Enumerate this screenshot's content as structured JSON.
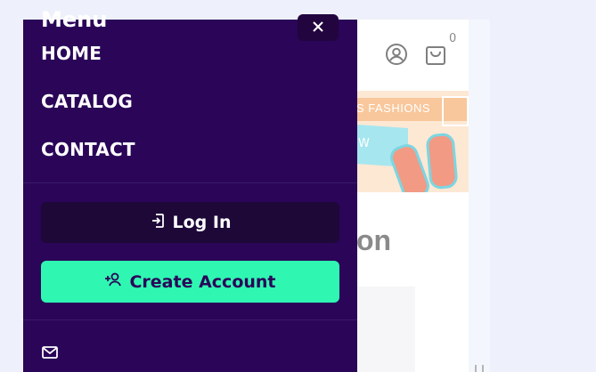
{
  "drawer": {
    "title": "Menu",
    "nav": [
      {
        "label": "HOME"
      },
      {
        "label": "CATALOG"
      },
      {
        "label": "CONTACT"
      }
    ],
    "login_label": "Log In",
    "create_account_label": "Create Account",
    "icons": {
      "close": "close-icon",
      "login": "sign-in-icon",
      "create": "user-plus-icon",
      "mail": "mail-icon"
    }
  },
  "header": {
    "cart_count": "0",
    "icons": [
      "account-icon",
      "cart-icon"
    ]
  },
  "banner": {
    "text": "S FASHIONS",
    "towel_text": "W"
  },
  "section": {
    "title_fragment": "on"
  },
  "colors": {
    "drawer_bg": "#2a0558",
    "login_bg": "#1d0838",
    "create_bg": "#2ff7b2",
    "create_text": "#2a0558",
    "page_bg": "#eef1fb"
  }
}
